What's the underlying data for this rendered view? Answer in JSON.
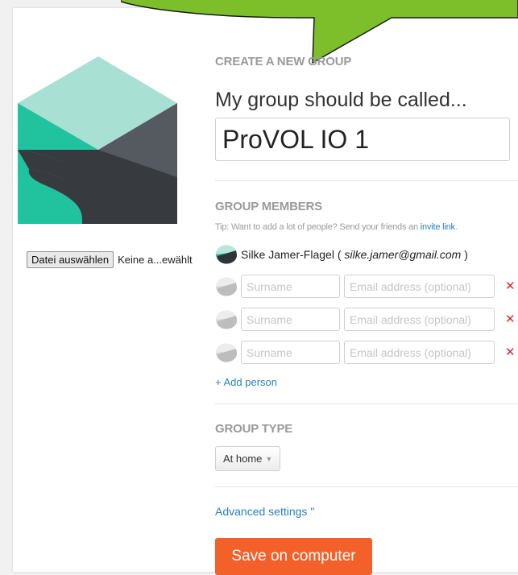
{
  "colors": {
    "accent_green": "#7dbf2b",
    "link_blue": "#2a7fc0",
    "save_orange": "#f4602a",
    "remove_red": "#d9262a",
    "logo_mint": "#a9e0d4",
    "logo_teal": "#20c39e",
    "logo_grey": "#545a60",
    "logo_dark": "#373b40"
  },
  "upload": {
    "button_label": "Datei auswählen",
    "status": "Keine a...ewählt"
  },
  "create": {
    "title": "CREATE A NEW GROUP",
    "prompt": "My group should be called...",
    "group_name": "ProVOL IO 1"
  },
  "members": {
    "title": "GROUP MEMBERS",
    "tip_text": "Tip: Want to add a lot of people? Send your friends an ",
    "tip_link": "invite link",
    "tip_end": ".",
    "owner": {
      "name": "Silke Jamer-Flagel",
      "open_paren": " ( ",
      "email": "silke.jamer@gmail.com",
      "close_paren": " )"
    },
    "rows": [
      {
        "surname": "",
        "email": ""
      },
      {
        "surname": "",
        "email": ""
      },
      {
        "surname": "",
        "email": ""
      }
    ],
    "surname_placeholder": "Surname",
    "email_placeholder": "Email address (optional)",
    "remove_symbol": "✕",
    "add_person": "+ Add person"
  },
  "group_type": {
    "title": "GROUP TYPE",
    "selected": "At home"
  },
  "advanced": "Advanced settings \"",
  "save_label": "Save on computer",
  "icons": [
    "avatar-icon",
    "caret-down-icon",
    "remove-icon",
    "speech-callout"
  ]
}
